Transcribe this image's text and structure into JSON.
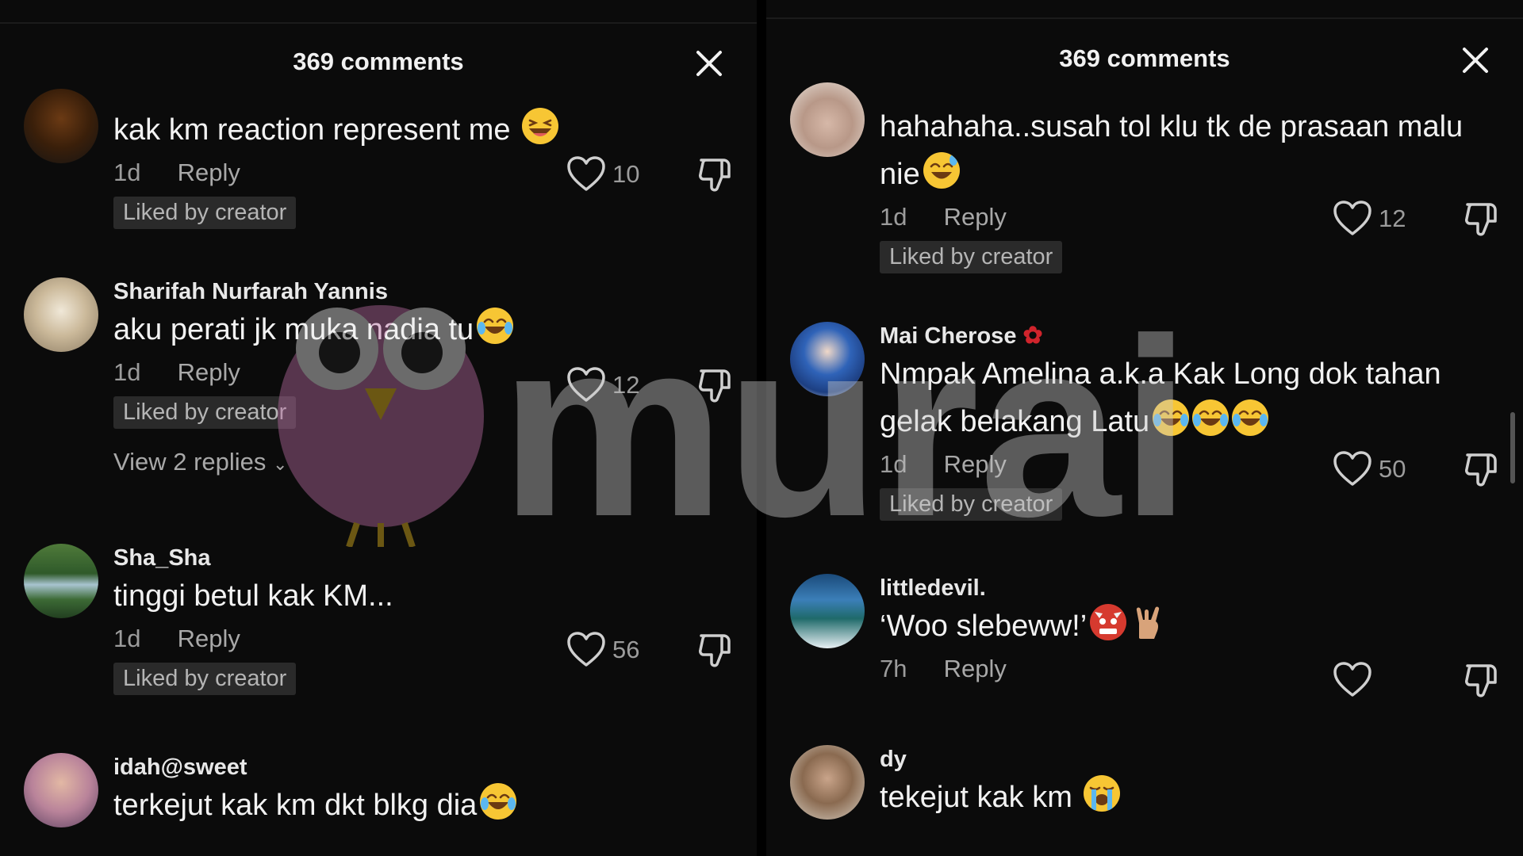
{
  "left_panel": {
    "title": "369 comments",
    "comments": [
      {
        "username": "",
        "text": "kak km reaction represent me",
        "time": "1d",
        "reply": "Reply",
        "likes": "10",
        "liked_badge": "Liked by creator"
      },
      {
        "username": "Sharifah Nurfarah Yannis",
        "text": "aku perati jk muka nadia tu",
        "time": "1d",
        "reply": "Reply",
        "likes": "12",
        "liked_badge": "Liked by creator",
        "view_replies": "View 2 replies"
      },
      {
        "username": "Sha_Sha",
        "text": "tinggi betul kak KM...",
        "time": "1d",
        "reply": "Reply",
        "likes": "56",
        "liked_badge": "Liked by creator"
      },
      {
        "username": "idah@sweet",
        "text": "terkejut kak km dkt blkg dia"
      }
    ]
  },
  "right_panel": {
    "title": "369 comments",
    "comments": [
      {
        "username": "",
        "text": "hahahaha..susah tol klu tk de prasaan malu nie",
        "time": "1d",
        "reply": "Reply",
        "likes": "12",
        "liked_badge": "Liked by creator"
      },
      {
        "username": "Mai Cherose",
        "text": "Nmpak Amelina a.k.a Kak Long dok tahan gelak belakang Latu",
        "time": "1d",
        "reply": "Reply",
        "likes": "50",
        "liked_badge": "Liked by creator"
      },
      {
        "username": "littledevil.",
        "text": "‘Woo slebeww!’",
        "time": "7h",
        "reply": "Reply",
        "likes": ""
      },
      {
        "username": "dy",
        "text": "tekejut kak km"
      }
    ]
  },
  "watermark": {
    "text": "murai"
  },
  "icons": {
    "close": "close-icon",
    "like": "heart-icon",
    "dislike": "thumbs-down-icon"
  },
  "colors": {
    "background": "#0b0b0b",
    "badge": "#2a2a2a",
    "muted_text": "#9c9c9c",
    "watermark_brand": "#c070a8"
  }
}
